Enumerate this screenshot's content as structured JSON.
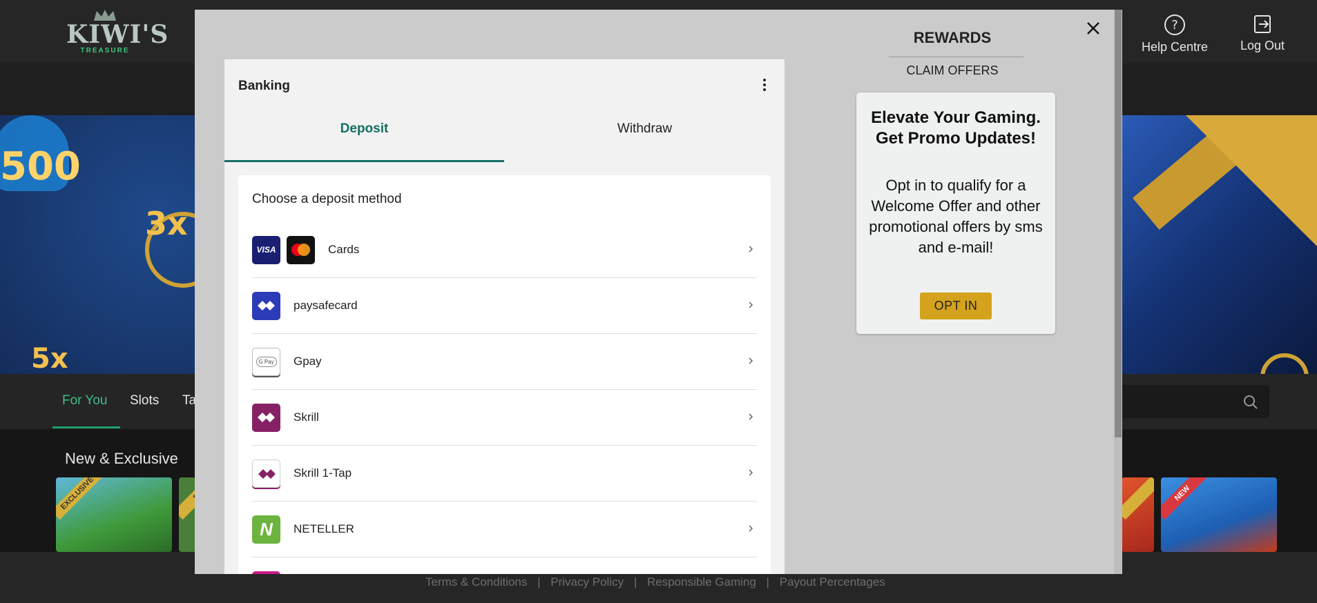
{
  "brand": {
    "logo_word": "KIWI'S",
    "logo_sub": "TREASURE"
  },
  "header": {
    "help_label": "Help Centre",
    "logout_label": "Log Out"
  },
  "banner": {
    "spade_text": "500",
    "multiplier_text": "3x",
    "multiplier_text_2": "5x"
  },
  "nav": {
    "tabs": [
      "For You",
      "Slots",
      "Ta"
    ],
    "active_tab": "For You"
  },
  "section": {
    "title": "New & Exclusive",
    "tiles": [
      {
        "ribbon": "EXCLUSIVE"
      },
      {
        "ribbon": "EXC"
      },
      {
        "ribbon": ""
      },
      {
        "ribbon": "NEW"
      }
    ]
  },
  "footer": {
    "links": [
      "Terms & Conditions",
      "Privacy Policy",
      "Responsible Gaming",
      "Payout Percentages"
    ],
    "separator": "|"
  },
  "modal": {
    "banking": {
      "title": "Banking",
      "tabs": {
        "deposit": "Deposit",
        "withdraw": "Withdraw",
        "active": "Deposit"
      },
      "methods_title": "Choose a deposit method",
      "methods": [
        {
          "label": "Cards",
          "icon": "visa-mastercard-icon"
        },
        {
          "label": "paysafecard",
          "icon": "paysafecard-icon"
        },
        {
          "label": "Gpay",
          "icon": "gpay-icon"
        },
        {
          "label": "Skrill",
          "icon": "skrill-icon"
        },
        {
          "label": "Skrill 1-Tap",
          "icon": "skrill-1-tap-icon"
        },
        {
          "label": "NETELLER",
          "icon": "neteller-icon"
        }
      ],
      "visa_text": "VISA",
      "gpay_text": "G Pay",
      "neteller_text": "N"
    },
    "rewards": {
      "title": "REWARDS",
      "claim_offers": "CLAIM OFFERS",
      "promo_heading": "Elevate Your Gaming. Get Promo Updates!",
      "promo_body": "Opt in to qualify for a Welcome Offer and other promotional offers by sms and e-mail!",
      "opt_in_label": "OPT IN"
    }
  },
  "colors": {
    "accent_green": "#136f63",
    "opt_in_gold": "#d4a21d",
    "modal_bg": "#cbcbcb"
  }
}
